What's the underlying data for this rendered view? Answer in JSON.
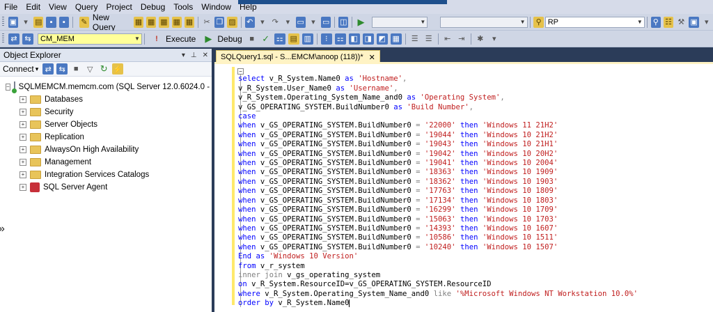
{
  "menu": [
    "File",
    "Edit",
    "View",
    "Query",
    "Project",
    "Debug",
    "Tools",
    "Window",
    "Help"
  ],
  "toolbar1": {
    "new_query": "New Query",
    "search_combo": "RP"
  },
  "toolbar2": {
    "database": "CM_MEM",
    "execute": "Execute",
    "debug": "Debug"
  },
  "object_explorer": {
    "title": "Object Explorer",
    "connect": "Connect",
    "server": "SQLMEMCM.memcm.com (SQL Server 12.0.6024.0 - MEM",
    "nodes": [
      "Databases",
      "Security",
      "Server Objects",
      "Replication",
      "AlwaysOn High Availability",
      "Management",
      "Integration Services Catalogs",
      "SQL Server Agent"
    ]
  },
  "editor": {
    "tab_title": "SQLQuery1.sql - S...EMCM\\anoop (118))*",
    "builds": [
      {
        "build": "'22000'",
        "name": "'Windows 11 21H2'"
      },
      {
        "build": "'19044'",
        "name": "'Windows 10 21H2'"
      },
      {
        "build": "'19043'",
        "name": "'Windows 10 21H1'"
      },
      {
        "build": "'19042'",
        "name": "'Windows 10 20H2'"
      },
      {
        "build": "'19041'",
        "name": "'Windows 10 2004'"
      },
      {
        "build": "'18363'",
        "name": "'Windows 10 1909'"
      },
      {
        "build": "'18362'",
        "name": "'Windows 10 1903'"
      },
      {
        "build": "'17763'",
        "name": "'Windows 10 1809'"
      },
      {
        "build": "'17134'",
        "name": "'Windows 10 1803'"
      },
      {
        "build": "'16299'",
        "name": "'Windows 10 1709'"
      },
      {
        "build": "'15063'",
        "name": "'Windows 10 1703'"
      },
      {
        "build": "'14393'",
        "name": "'Windows 10 1607'"
      },
      {
        "build": "'10586'",
        "name": "'Windows 10 1511'"
      },
      {
        "build": "'10240'",
        "name": "'Windows 10 1507'"
      }
    ],
    "code": {
      "l1_kw": "select",
      "l1_tx": " v_R_System.Name0 ",
      "l1_as": "as",
      "l1_str": " 'Hostname'",
      "l1_c": ",",
      "l2_tx": "v_R_System.User_Name0 ",
      "l2_as": "as",
      "l2_str": " 'Username'",
      "l2_c": ",",
      "l3_tx": "v_R_System.Operating_System_Name_and0 ",
      "l3_as": "as",
      "l3_str": " 'Operating System'",
      "l3_c": ",",
      "l4_tx": "v_GS_OPERATING_SYSTEM.BuildNumber0 ",
      "l4_as": "as",
      "l4_str": " 'Build Number'",
      "l4_c": ",",
      "case": "case",
      "when": "when",
      "when_field": " v_GS_OPERATING_SYSTEM.BuildNumber0 ",
      "eq": "=",
      "then": "then",
      "end": "End",
      "end_as": "as",
      "end_str": " 'Windows 10 Version'",
      "from": "from",
      "from_tx": " v_r_system",
      "join": "inner join",
      "join_tx": " v_gs_operating_system",
      "on": "on",
      "on_tx": " v_R_System.ResourceID=v_GS_OPERATING_SYSTEM.ResourceID",
      "where": "where",
      "where_tx": " v_R_System.Operating_System_Name_and0 ",
      "like": "like",
      "like_str": " '%Microsoft Windows NT Workstation 10.0%'",
      "order": "order by",
      "order_tx": " v_R_System.Name0"
    }
  },
  "colors": {
    "keyword": "#0000ff",
    "string": "#c01e1e",
    "operator": "#808080",
    "tab": "#fff3c4",
    "db_combo": "#ffff99"
  }
}
